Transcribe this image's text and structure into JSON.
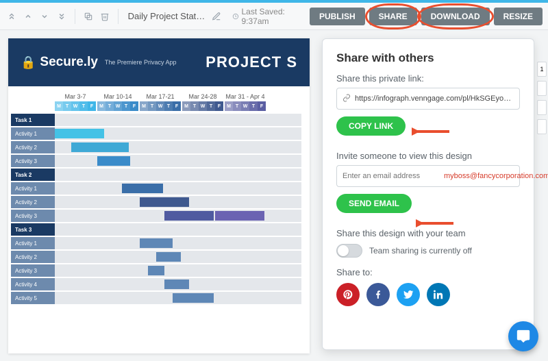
{
  "toolbar": {
    "doc_title": "Daily Project Status G...",
    "last_saved": "Last Saved: 9:37am",
    "buttons": {
      "publish": "PUBLISH",
      "share": "SHARE",
      "download": "DOWNLOAD",
      "resize": "RESIZE"
    }
  },
  "banner": {
    "brand_name": "Secure.ly",
    "brand_tag": "The Premiere Privacy App",
    "title": "PROJECT S"
  },
  "gantt": {
    "day_letters": [
      "M",
      "T",
      "W",
      "T",
      "F"
    ],
    "week_labels": [
      "Mar 3-7",
      "Mar 10-14",
      "Mar 17-21",
      "Mar 24-28",
      "Mar 31 - Apr 4"
    ],
    "week_colors": [
      "#3fb6e8",
      "#3a8bc9",
      "#3a6ea8",
      "#3f598f",
      "#5a5ea2",
      "#7a6fba"
    ],
    "rows": [
      {
        "label": "Task 1",
        "type": "task",
        "bars": []
      },
      {
        "label": "Activity 1",
        "type": "act",
        "bars": [
          {
            "start": 0,
            "span": 6,
            "color": "#44c2e6"
          }
        ]
      },
      {
        "label": "Activity 2",
        "type": "act",
        "bars": [
          {
            "start": 2,
            "span": 7,
            "color": "#3fa9d6"
          }
        ]
      },
      {
        "label": "Activity 3",
        "type": "act",
        "bars": [
          {
            "start": 5,
            "span": 4,
            "color": "#3a8bc9"
          }
        ]
      },
      {
        "label": "Task 2",
        "type": "task",
        "bars": []
      },
      {
        "label": "Activity 1",
        "type": "act",
        "bars": [
          {
            "start": 8,
            "span": 5,
            "color": "#3a6ea8"
          }
        ]
      },
      {
        "label": "Activity 2",
        "type": "act",
        "bars": [
          {
            "start": 10,
            "span": 6,
            "color": "#3f598f"
          }
        ]
      },
      {
        "label": "Activity 3",
        "type": "act",
        "bars": [
          {
            "start": 13,
            "span": 6,
            "color": "#4f5aa0"
          },
          {
            "start": 19,
            "span": 6,
            "color": "#6b63b2"
          }
        ]
      },
      {
        "label": "Task 3",
        "type": "task",
        "bars": []
      },
      {
        "label": "Activity 1",
        "type": "act",
        "bars": [
          {
            "start": 10,
            "span": 4,
            "color": "#5e87b6"
          }
        ]
      },
      {
        "label": "Activity 2",
        "type": "act",
        "bars": [
          {
            "start": 12,
            "span": 3,
            "color": "#5e87b6"
          }
        ]
      },
      {
        "label": "Activity 3",
        "type": "act",
        "bars": [
          {
            "start": 11,
            "span": 2,
            "color": "#5e87b6"
          }
        ]
      },
      {
        "label": "Activity 4",
        "type": "act",
        "bars": [
          {
            "start": 13,
            "span": 3,
            "color": "#5e87b6"
          }
        ]
      },
      {
        "label": "Activity 5",
        "type": "act",
        "bars": [
          {
            "start": 14,
            "span": 5,
            "color": "#5e87b6"
          }
        ]
      }
    ]
  },
  "share_panel": {
    "title": "Share with others",
    "private_label": "Share this private link:",
    "private_url": "https://infograph.venngage.com/pl/HkSGEyoQsU",
    "copy_btn": "COPY LINK",
    "invite_label": "Invite someone to view this design",
    "email_placeholder": "Enter an email address",
    "email_example": "myboss@fancycorporation.com",
    "send_btn": "SEND EMAIL",
    "team_label": "Share this design with your team",
    "team_status": "Team sharing is currently off",
    "share_to": "Share to:"
  },
  "side_handle_label": "1"
}
